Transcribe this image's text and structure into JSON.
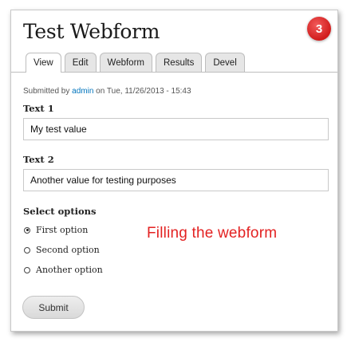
{
  "page": {
    "title": "Test Webform",
    "step_badge": "3"
  },
  "tabs": [
    {
      "label": "View",
      "active": true
    },
    {
      "label": "Edit",
      "active": false
    },
    {
      "label": "Webform",
      "active": false
    },
    {
      "label": "Results",
      "active": false
    },
    {
      "label": "Devel",
      "active": false
    }
  ],
  "submitted": {
    "prefix": "Submitted by ",
    "author": "admin",
    "suffix": " on Tue, 11/26/2013 - 15:43"
  },
  "form": {
    "text1": {
      "label": "Text 1",
      "value": "My test value"
    },
    "text2": {
      "label": "Text 2",
      "value": "Another value for testing purposes"
    },
    "select_options": {
      "label": "Select options",
      "options": [
        {
          "label": "First option",
          "checked": true
        },
        {
          "label": "Second option",
          "checked": false
        },
        {
          "label": "Another option",
          "checked": false
        }
      ]
    },
    "submit_label": "Submit"
  },
  "annotation": {
    "text": "Filling the webform",
    "color": "#e32222"
  },
  "colors": {
    "link": "#0074bd",
    "badge": "#d11c1c"
  }
}
